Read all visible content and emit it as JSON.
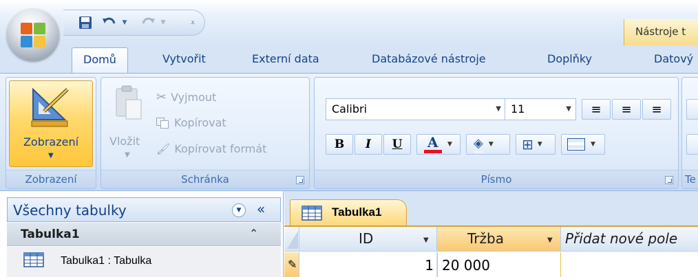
{
  "window": {
    "context_tab_title": "Nástroje t"
  },
  "tabs": [
    {
      "label": "Domů",
      "active": true
    },
    {
      "label": "Vytvořit"
    },
    {
      "label": "Externí data"
    },
    {
      "label": "Databázové nástroje"
    },
    {
      "label": "Doplňky"
    },
    {
      "label": "Datový"
    }
  ],
  "ribbon": {
    "views": {
      "button_label": "Zobrazení",
      "group_label": "Zobrazení"
    },
    "clipboard": {
      "paste_label": "Vložit",
      "cut_label": "Vyjmout",
      "copy_label": "Kopírovat",
      "format_painter_label": "Kopírovat formát",
      "group_label": "Schránka"
    },
    "font": {
      "font_name": "Calibri",
      "font_size": "11",
      "bold": "B",
      "italic": "I",
      "underline": "U",
      "font_color_letter": "A",
      "font_color": "#e81123",
      "group_label": "Písmo"
    },
    "next_group_label": "Te"
  },
  "navigation": {
    "title": "Všechny tabulky",
    "group_title": "Tabulka1",
    "items": [
      {
        "label": "Tabulka1 : Tabulka"
      }
    ]
  },
  "document": {
    "tab_label": "Tabulka1",
    "columns": [
      {
        "label": "ID"
      },
      {
        "label": "Tržba"
      },
      {
        "label": "Přidat nové pole"
      }
    ],
    "rows": [
      {
        "id": "1",
        "trzba": "20 000"
      }
    ]
  }
}
